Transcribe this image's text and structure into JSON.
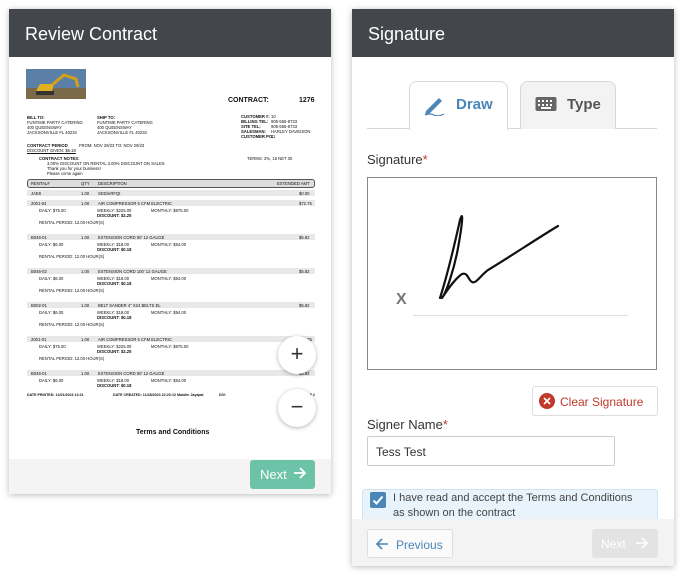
{
  "left_panel": {
    "title": "Review Contract",
    "zoom_in": "+",
    "zoom_out": "−",
    "next_label": "Next",
    "document": {
      "contract_label": "CONTRACT:",
      "contract_no": "1276",
      "bill_to": "BILL TO:",
      "bill_to_lines": [
        "FUNTIME PARTY CATERING",
        "400 QUEENSWAY",
        "JACKSONVILLE FL 40234"
      ],
      "ship_to": "SHIP TO:",
      "ship_to_lines": [
        "FUNTIME PARTY CATERING",
        "400 QUEENSWAY",
        "JACKSONVILLE FL 40234"
      ],
      "info_labels": [
        "CUSTOMER #:",
        "BILLING TEL:",
        "SITE TEL:",
        "SALESMAN:",
        "CUSTOMER PO:"
      ],
      "info_values": [
        "10",
        "905-555-8733",
        "905-555-8733",
        "HARLEY DAVIDSON",
        "11"
      ],
      "contract_period_label": "CONTRACT PERIOD",
      "contract_period": "FROM: NOV 28/23  TO: NOV 29/23",
      "discount_given": "DISCOUNT GIVEN: $6.18",
      "terms": "TERMS:  2%, 15 NET 30",
      "contract_notes_label": "CONTRACT NOTES:",
      "contract_notes": [
        "3.00% DISCOUNT ON RENTAL     3.00% DISCOUNT ON SALES",
        "Thank you for your business!",
        "Please come again"
      ],
      "columns": [
        "RENTAL#",
        "QTY",
        "DESCRIPTION",
        "EXTENDED AMT"
      ],
      "rows": [
        {
          "no": "JAE8",
          "qty": "1.00",
          "desc": "SDD/eRFQt",
          "amt": "$0.00"
        },
        {
          "no": "2001-04",
          "qty": "1.00",
          "desc": "AIR COMPRESSOR 5 CFM ELECTRIC",
          "amt": "$72.75",
          "daily": "DAILY: $75.00",
          "weekly": "WEEKLY: $225.00",
          "monthly": "MONTHLY: $675.00",
          "discount": "DISCOUNT:        $2.25",
          "period": "RENTAL PERIOD: 12.00 HOUR(S)"
        },
        {
          "no": "B046-01",
          "qty": "1.00",
          "desc": "EXTENSION CORD 50' 12 GAUGE",
          "amt": "$5.82",
          "daily": "DAILY: $6.00",
          "weekly": "WEEKLY: $18.00",
          "monthly": "MONTHLY: $54.00",
          "discount": "DISCOUNT:        $0.18",
          "period": "RENTAL PERIOD: 12.00 HOUR(S)"
        },
        {
          "no": "B046-02",
          "qty": "1.00",
          "desc": "EXTENSION CORD 100' 12 GAUGE",
          "amt": "$5.82",
          "daily": "DAILY: $6.00",
          "weekly": "WEEKLY: $18.00",
          "monthly": "MONTHLY: $54.00",
          "discount": "DISCOUNT:        $0.18",
          "period": "RENTAL PERIOD: 12.00 HOUR(S)"
        },
        {
          "no": "B002-01",
          "qty": "1.00",
          "desc": "BELT SANDER 4\" X24 BELTS EL",
          "amt": "$5.82",
          "daily": "DAILY: $6.00",
          "weekly": "WEEKLY: $18.00",
          "monthly": "MONTHLY: $54.00",
          "discount": "DISCOUNT:        $0.18",
          "period": "RENTAL PERIOD: 12.00 HOUR(S)"
        },
        {
          "no": "2001-01",
          "qty": "1.00",
          "desc": "AIR COMPRESSOR 5 CFM ELECTRIC",
          "amt": "$72.75",
          "daily": "DAILY: $75.00",
          "weekly": "WEEKLY: $225.00",
          "monthly": "MONTHLY: $675.00",
          "discount": "DISCOUNT:        $2.25",
          "period": "RENTAL PERIOD: 12.00 HOUR(S)"
        },
        {
          "no": "B046-01",
          "qty": "1.00",
          "desc": "EXTENSION CORD 50' 12 GAUGE",
          "amt": "$5.82",
          "daily": "DAILY: $6.00",
          "weekly": "WEEKLY: $18.00",
          "monthly": "MONTHLY: $54.00",
          "discount": "DISCOUNT:        $0.18",
          "period": ""
        }
      ],
      "date_printed": "DATE PRINTED: 12/01/2023 13:21",
      "date_created": "DATE CREATED: 11/28/2023 22:20:12  Malolin Jayapal",
      "div": "DIV:",
      "page": "PAGE 1 OF 2",
      "terms_and_conditions": "Terms and Conditions"
    }
  },
  "right_panel": {
    "title": "Signature",
    "tabs": [
      {
        "label": "Draw",
        "active": true
      },
      {
        "label": "Type",
        "active": false
      }
    ],
    "signature_label": "Signature",
    "required_mark": "*",
    "x_mark": "X",
    "clear_label": "Clear Signature",
    "signer_label": "Signer Name",
    "signer_value": "Tess Test",
    "terms_line1": "I have read and accept the Terms and Conditions",
    "terms_line2": "as shown on the contract",
    "terms_checked": true,
    "previous_label": "Previous",
    "next_label": "Next"
  },
  "colors": {
    "header": "#43464a",
    "accent": "#4a86b8",
    "next_green": "#6cc3a8",
    "danger": "#c0392b"
  }
}
